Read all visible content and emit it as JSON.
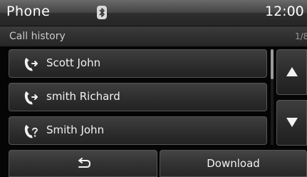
{
  "status_bar": {
    "title": "Phone",
    "time": "12:00",
    "bluetooth_icon": "bluetooth-icon"
  },
  "header": {
    "subtitle": "Call history",
    "page_indicator": "1/8"
  },
  "call_list": [
    {
      "name": "Scott John",
      "icon": "outgoing-call-icon"
    },
    {
      "name": "smith Richard",
      "icon": "outgoing-call-icon"
    },
    {
      "name": "Smith John",
      "icon": "missed-call-icon"
    }
  ],
  "scroll": {
    "up_icon": "arrow-up-icon",
    "down_icon": "arrow-down-icon"
  },
  "bottom_bar": {
    "back_icon": "back-arrow-icon",
    "download_label": "Download"
  },
  "colors": {
    "background": "#050505",
    "text": "#f2f2f2",
    "button_border": "#555555"
  }
}
